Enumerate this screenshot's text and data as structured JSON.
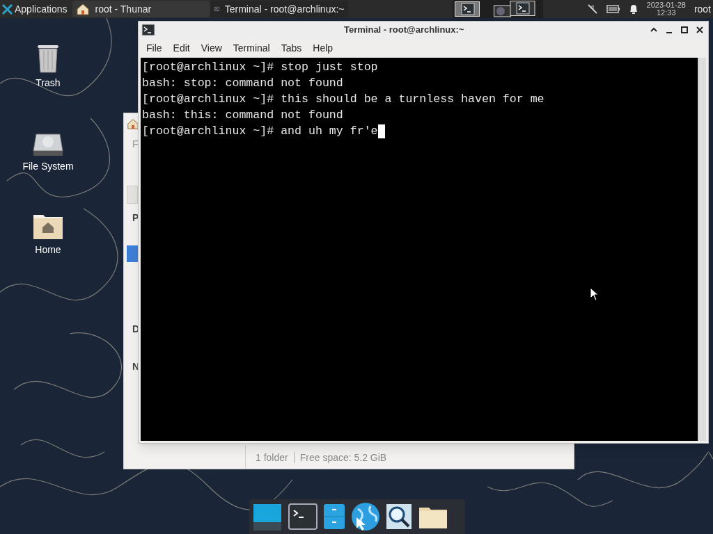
{
  "panel": {
    "menu_label": "Applications",
    "tasks": [
      {
        "title": "root - Thunar",
        "kind": "folder",
        "selected": false
      },
      {
        "title": "Terminal - root@archlinux:~",
        "kind": "terminal",
        "selected": true
      }
    ],
    "clock": {
      "date": "2023-01-28",
      "time": "12:33"
    },
    "user": "root"
  },
  "desktop_icons": [
    {
      "label": "Trash",
      "kind": "trash"
    },
    {
      "label": "File System",
      "kind": "drive"
    },
    {
      "label": "Home",
      "kind": "home"
    }
  ],
  "thunar": {
    "menu_fragment": "F",
    "side_letters": [
      "P",
      "D",
      "N"
    ],
    "status": [
      "1 folder",
      "Free space: 5.2 GiB"
    ]
  },
  "terminal": {
    "title": "Terminal - root@archlinux:~",
    "menu": [
      "File",
      "Edit",
      "View",
      "Terminal",
      "Tabs",
      "Help"
    ],
    "lines": [
      "[root@archlinux ~]# stop just stop",
      "bash: stop: command not found",
      "[root@archlinux ~]# this should be a turnless haven for me",
      "bash: this: command not found",
      "[root@archlinux ~]# and uh my fr'e"
    ],
    "cursor": true
  }
}
